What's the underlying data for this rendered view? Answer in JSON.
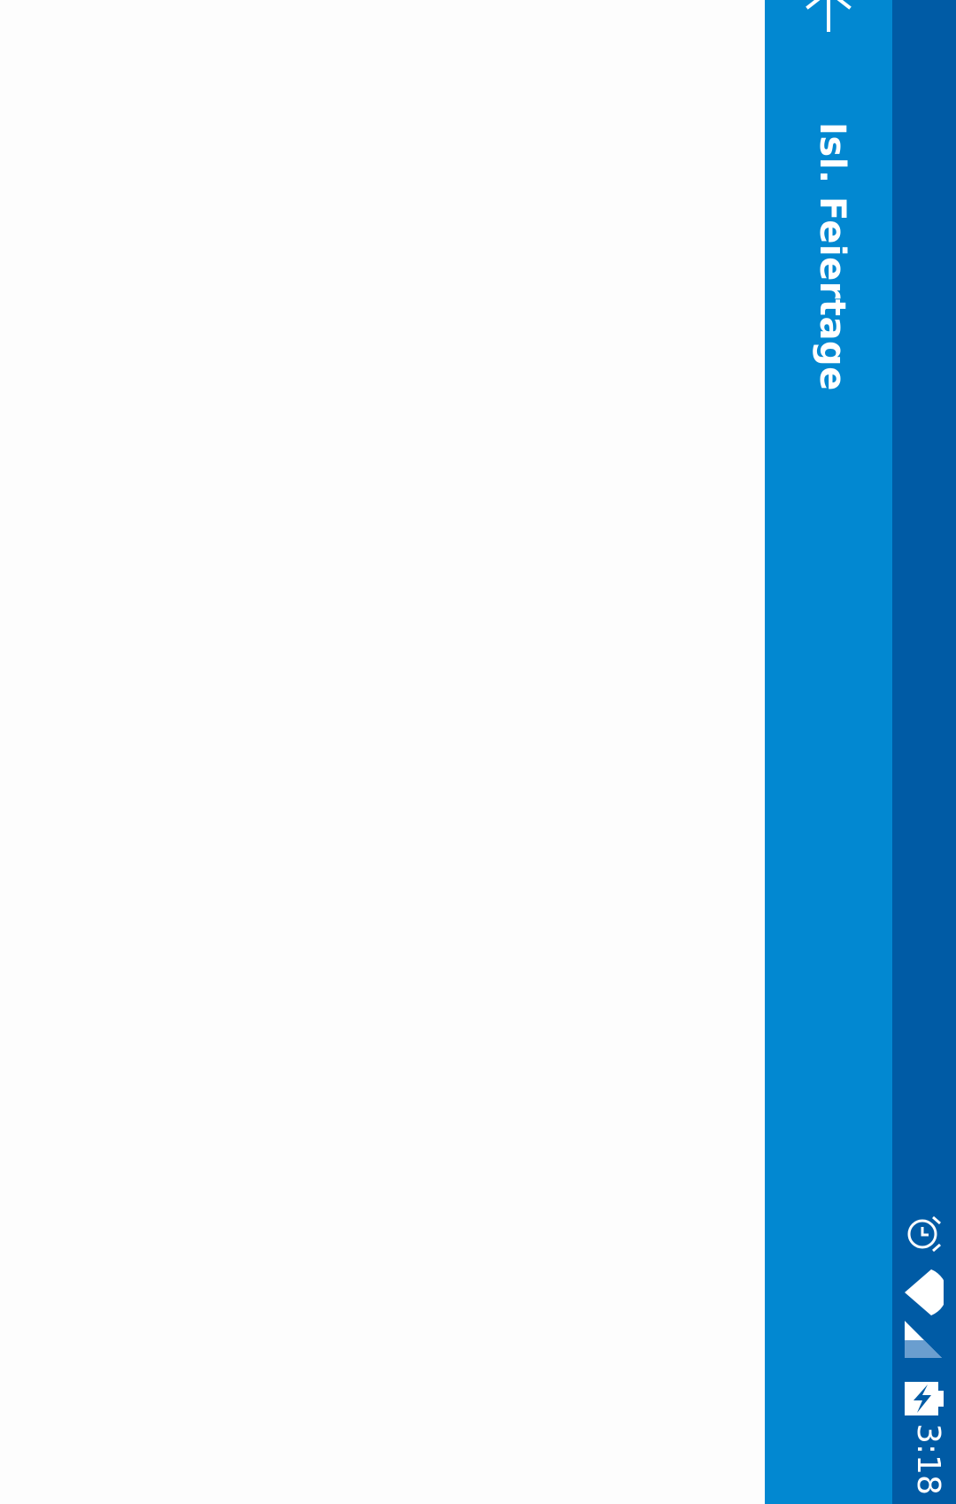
{
  "app": {
    "title": "Isl. Feiertage"
  },
  "toolbar": {
    "back_icon": "arrow-up-icon",
    "color": "#0288d1"
  },
  "status_bar": {
    "time": "3:18",
    "icons": [
      "alarm-icon",
      "wifi-icon",
      "cell-signal-icon",
      "battery-charging-icon"
    ],
    "color": "#005ba5"
  },
  "content": {
    "background": "#fdfdfd"
  }
}
